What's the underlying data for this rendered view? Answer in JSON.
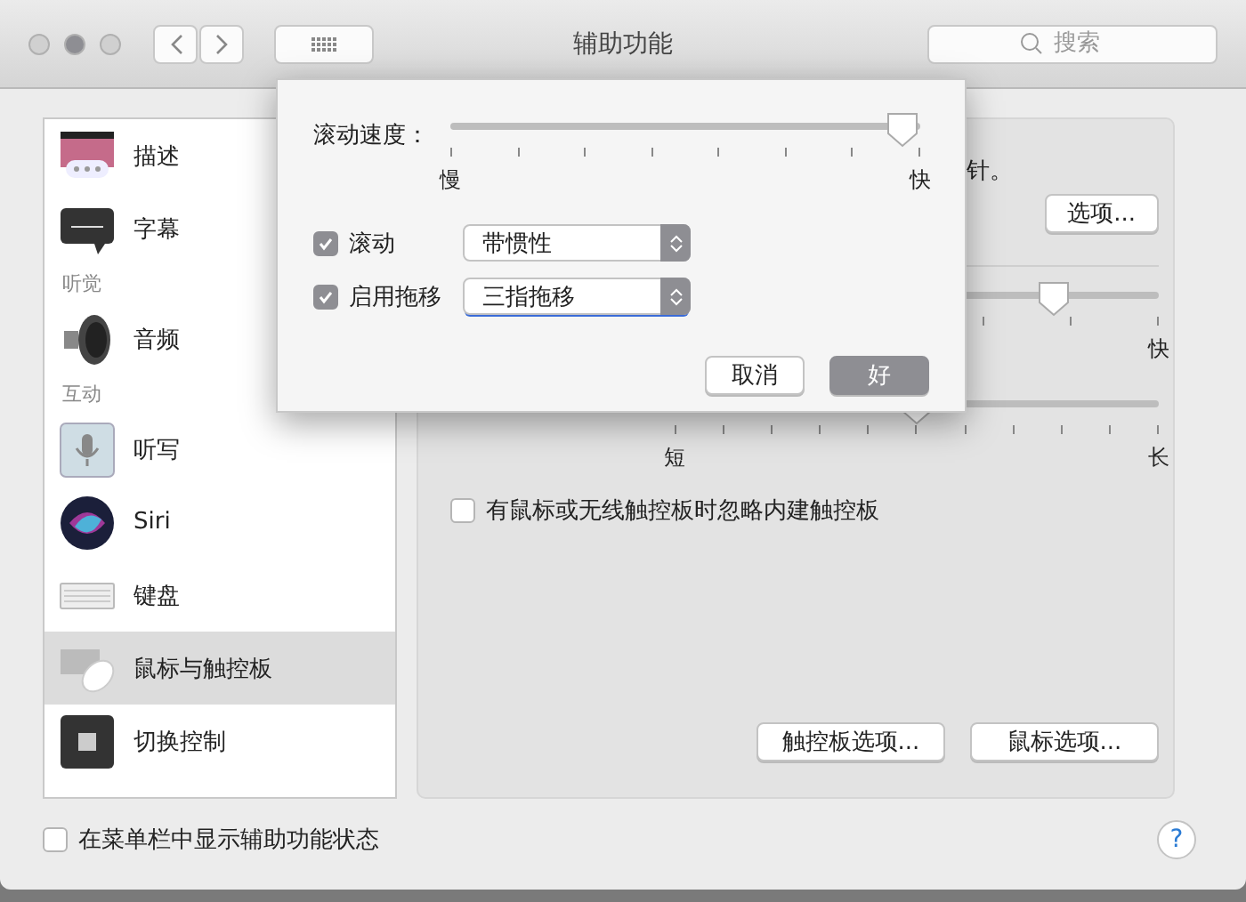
{
  "window": {
    "title": "辅助功能",
    "search_placeholder": "搜索"
  },
  "sidebar": {
    "items": [
      {
        "kind": "item",
        "label": "描述",
        "selected": false
      },
      {
        "kind": "item",
        "label": "字幕",
        "selected": false
      },
      {
        "kind": "header",
        "label": "听觉"
      },
      {
        "kind": "item",
        "label": "音频",
        "selected": false
      },
      {
        "kind": "header",
        "label": "互动"
      },
      {
        "kind": "item",
        "label": "听写",
        "selected": false
      },
      {
        "kind": "item",
        "label": "Siri",
        "selected": false
      },
      {
        "kind": "item",
        "label": "键盘",
        "selected": false
      },
      {
        "kind": "item",
        "label": "鼠标与触控板",
        "selected": true
      },
      {
        "kind": "item",
        "label": "切换控制",
        "selected": false
      }
    ]
  },
  "panel": {
    "description": "针。",
    "options_button": "选项...",
    "sliders": [
      {
        "level": 0.85,
        "max_label": "快"
      },
      {
        "level": 0.5,
        "min_label": "短",
        "max_label": "长"
      }
    ],
    "ignore_checkbox": {
      "label": "有鼠标或无线触控板时忽略内建触控板",
      "checked": false
    },
    "buttons": [
      "触控板选项...",
      "鼠标选项..."
    ]
  },
  "sheet": {
    "speed": {
      "label": "滚动速度：",
      "level": 1,
      "min_label": "慢",
      "max_label": "快"
    },
    "rows": [
      {
        "label": "滚动",
        "checked": true,
        "value": "带惯性",
        "focused": false
      },
      {
        "label": "启用拖移",
        "checked": true,
        "value": "三指拖移",
        "focused": true
      }
    ],
    "cancel_button": "取消",
    "ok_button": "好"
  },
  "footer": {
    "checkbox": {
      "label": "在菜单栏中显示辅助功能状态",
      "checked": false
    },
    "help": "?"
  }
}
